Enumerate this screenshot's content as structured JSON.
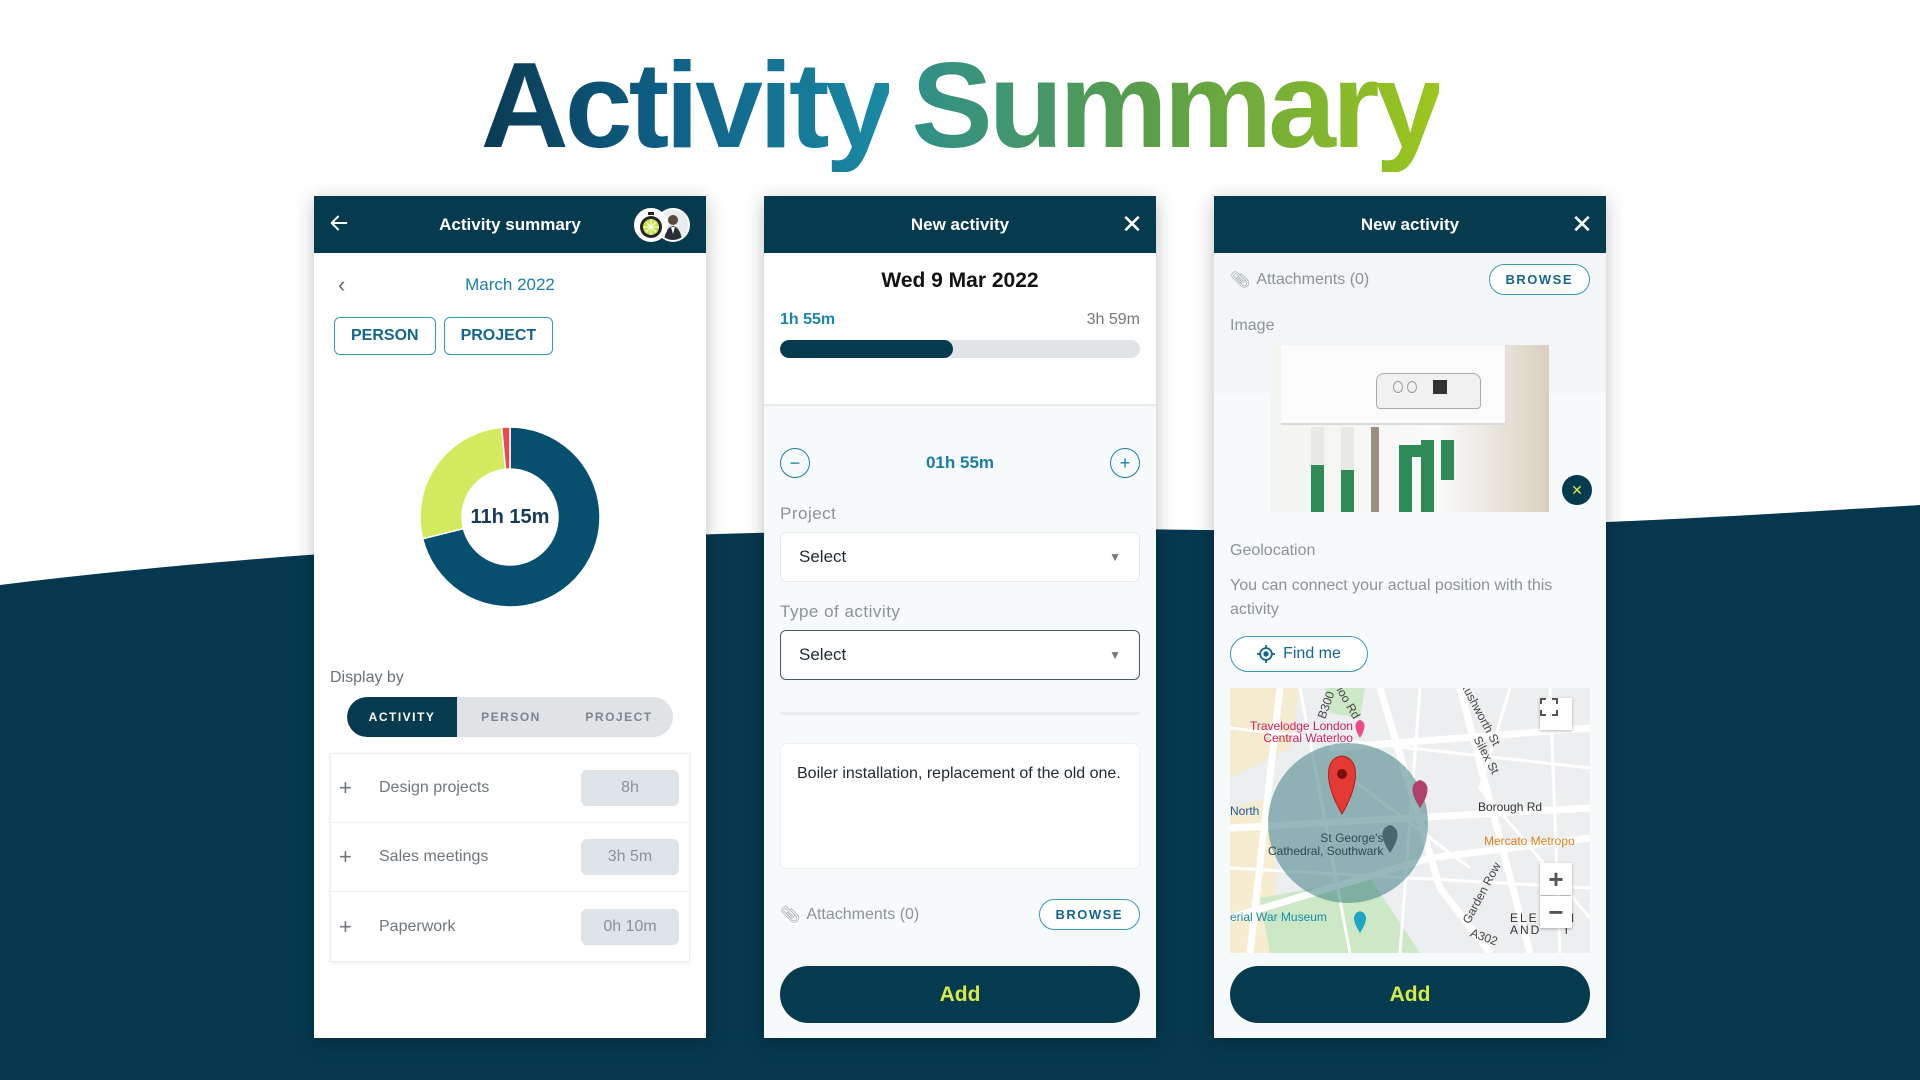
{
  "hero": {
    "title_word1": "Activity",
    "title_word2": "Summary"
  },
  "colors": {
    "brand_dark": "#063a4f",
    "accent_teal": "#1a7fa6",
    "accent_lime": "#d8ea4a",
    "segment_red": "#e84a4f",
    "segment_lime": "#d4ea5e"
  },
  "panel1": {
    "header": {
      "title": "Activity summary",
      "back_icon": "arrow-left-icon"
    },
    "month": {
      "label": "March 2022",
      "prev_icon": "chevron-left-icon"
    },
    "filter_chips": [
      "PERSON",
      "PROJECT"
    ],
    "chart_data": {
      "type": "pie",
      "title": "",
      "center_label": "11h 15m",
      "categories": [
        "Design projects",
        "Sales meetings",
        "Paperwork"
      ],
      "values_minutes": [
        480,
        185,
        10
      ],
      "colors": [
        "#064f6e",
        "#d4ea5e",
        "#e84a4f"
      ]
    },
    "display_by": {
      "label": "Display by",
      "options": [
        "ACTIVITY",
        "PERSON",
        "PROJECT"
      ],
      "selected": "ACTIVITY"
    },
    "activities": [
      {
        "name": "Design projects",
        "duration": "8h"
      },
      {
        "name": "Sales meetings",
        "duration": "3h 5m"
      },
      {
        "name": "Paperwork",
        "duration": "0h 10m"
      }
    ]
  },
  "panel2": {
    "header": {
      "title": "New activity",
      "close_icon": "close-icon"
    },
    "date": "Wed 9 Mar 2022",
    "progress": {
      "current_label": "1h 55m",
      "total_label": "3h 59m",
      "fraction": 0.481
    },
    "stepper": {
      "value": "01h 55m"
    },
    "project": {
      "label": "Project",
      "value": "Select"
    },
    "activity_type": {
      "label": "Type of activity",
      "value": "Select"
    },
    "notes": "Boiler installation, replacement of the old one.",
    "attachments": {
      "label": "Attachments (0)",
      "browse": "BROWSE"
    },
    "add_label": "Add"
  },
  "panel3": {
    "header": {
      "title": "New activity",
      "close_icon": "close-icon"
    },
    "attachments": {
      "label": "Attachments (0)",
      "browse": "BROWSE"
    },
    "image_label": "Image",
    "geolocation": {
      "label": "Geolocation",
      "description": "You can connect your actual position with this activity",
      "find_me": "Find me"
    },
    "map": {
      "labels": {
        "travelodge": "Travelodge London\nCentral Waterloo",
        "north": "North",
        "borough_rd": "Borough Rd",
        "mercato": "Mercato Metropo",
        "st_georges": "St George's\nCathedral, Southwark",
        "war_museum": "erial War Museum",
        "garden_row": "Garden Row",
        "b300": "B300",
        "rd": "rloo Rd",
        "rushworth": "Rushworth St",
        "silex": "Silex St",
        "a302": "A302",
        "ele": "ELE    N\nAND    T"
      }
    },
    "add_label": "Add"
  }
}
